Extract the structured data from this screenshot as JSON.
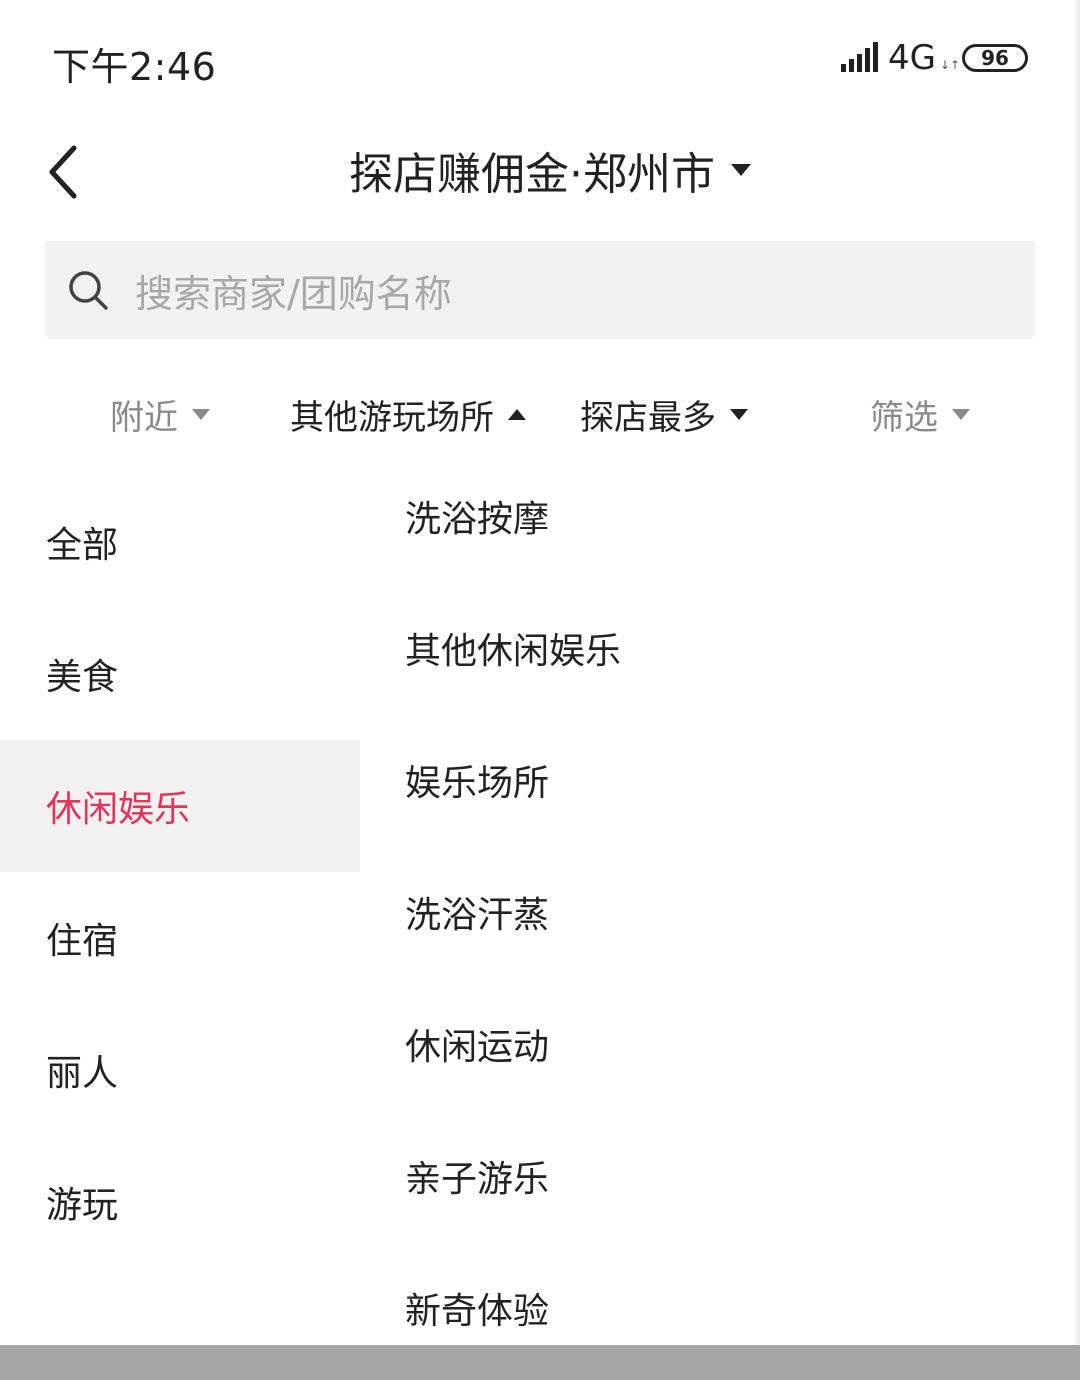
{
  "status_bar": {
    "time": "下午2:46",
    "network": "4G",
    "network_arrows": "↓↑",
    "battery": "96"
  },
  "header": {
    "title": "探店赚佣金·郑州市",
    "back_icon": "chevron-left-icon",
    "caret_icon": "caret-down-icon"
  },
  "search": {
    "placeholder": "搜索商家/团购名称",
    "icon": "search-icon"
  },
  "filters": [
    {
      "label": "附近",
      "state": "collapsed"
    },
    {
      "label": "其他游玩场所",
      "state": "expanded"
    },
    {
      "label": "探店最多",
      "state": "collapsed"
    },
    {
      "label": "筛选",
      "state": "collapsed"
    }
  ],
  "categories": {
    "items": [
      {
        "label": "全部"
      },
      {
        "label": "美食"
      },
      {
        "label": "休闲娱乐"
      },
      {
        "label": "住宿"
      },
      {
        "label": "丽人"
      },
      {
        "label": "游玩"
      }
    ],
    "selected": "休闲娱乐"
  },
  "subcategories": {
    "items": [
      {
        "label": "洗浴按摩"
      },
      {
        "label": "其他休闲娱乐"
      },
      {
        "label": "娱乐场所"
      },
      {
        "label": "洗浴汗蒸"
      },
      {
        "label": "休闲运动"
      },
      {
        "label": "亲子游乐"
      },
      {
        "label": "新奇体验"
      }
    ]
  },
  "colors": {
    "accent": "#e5335a",
    "text_primary": "#222222",
    "text_muted": "#8a8a8a",
    "search_bg": "#f2f2f2",
    "selected_bg": "#f2f2f2"
  }
}
